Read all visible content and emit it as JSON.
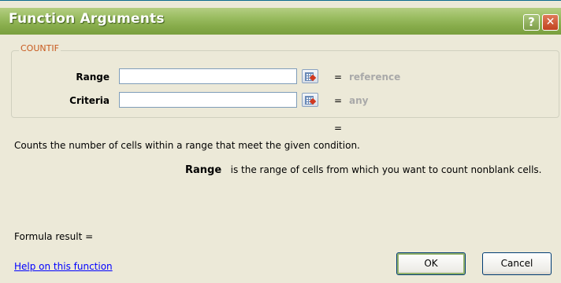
{
  "window": {
    "title": "Function Arguments",
    "help_glyph": "?",
    "close_glyph": "✕"
  },
  "function": {
    "name": "COUNTIF",
    "arguments": [
      {
        "label": "Range",
        "value": "",
        "equals": "=",
        "result": "reference"
      },
      {
        "label": "Criteria",
        "value": "",
        "equals": "=",
        "result": "any"
      }
    ],
    "overall_equals": "="
  },
  "description": "Counts the number of cells within a range that meet the given condition.",
  "argument_help": {
    "name": "Range",
    "text": "is the range of cells from which you want to count nonblank cells."
  },
  "formula_result_label": "Formula result =",
  "help_link": "Help on this function",
  "buttons": {
    "ok": "OK",
    "cancel": "Cancel"
  },
  "colors": {
    "titlebar": "#9bbd62",
    "group_title": "#c85a1e",
    "dialog_bg": "#ece9d8",
    "link": "#0000ff"
  }
}
